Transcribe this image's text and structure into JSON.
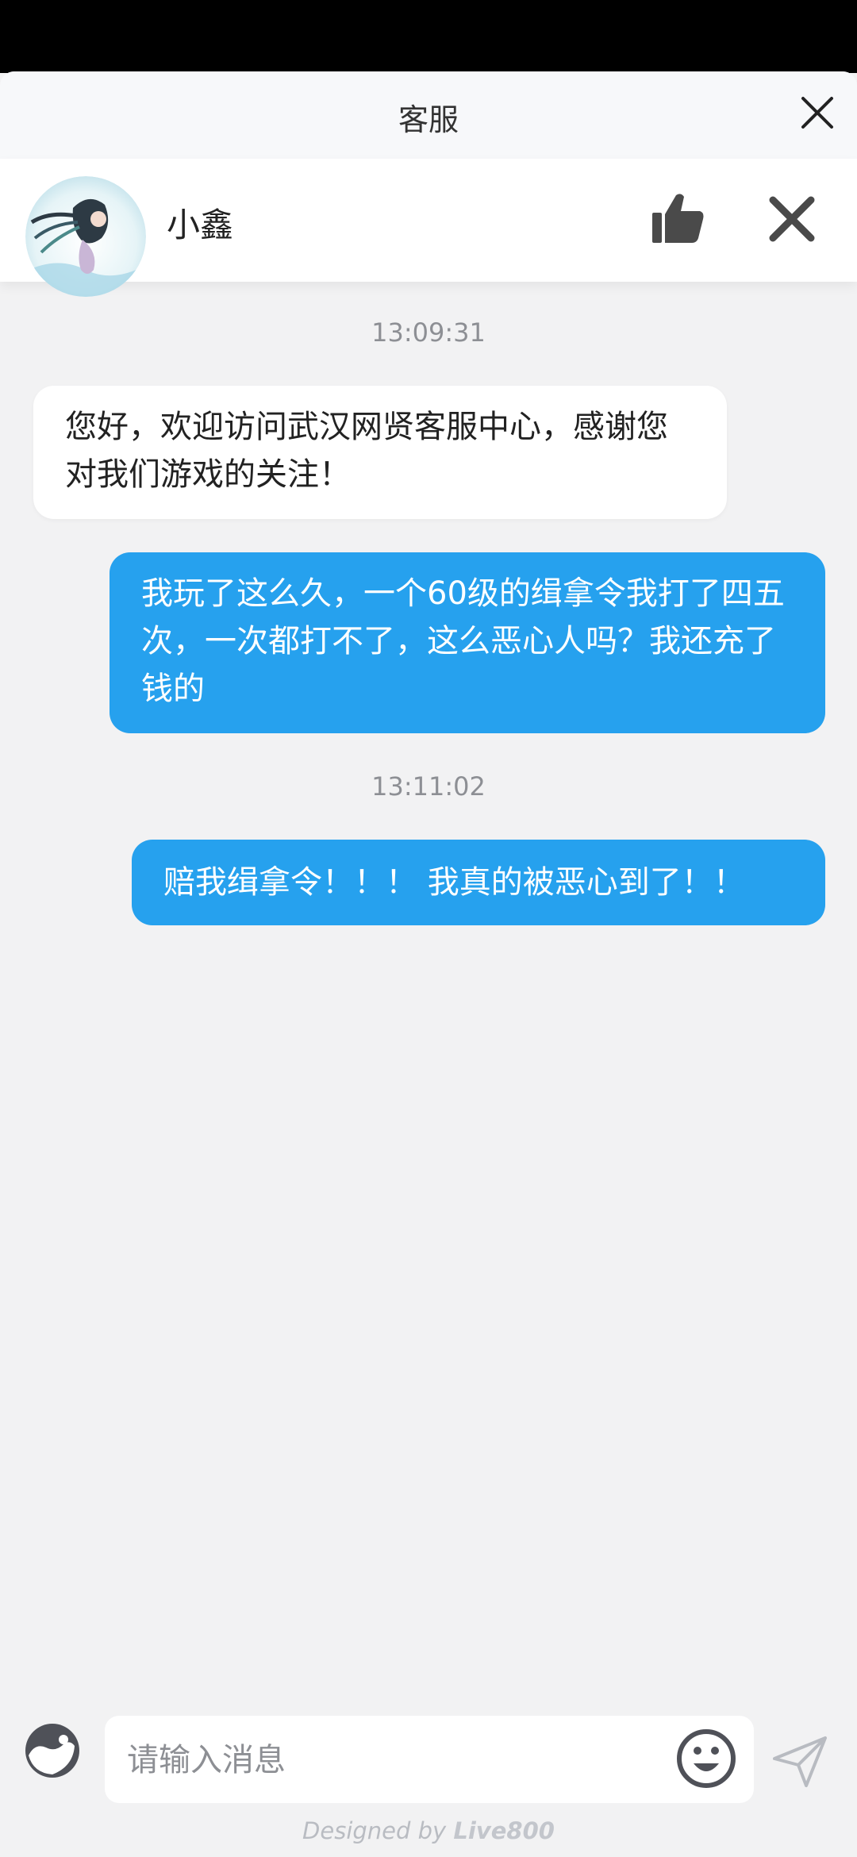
{
  "window": {
    "title": "客服"
  },
  "agent": {
    "name": "小鑫"
  },
  "messages": [
    {
      "type": "timestamp",
      "text": "13:09:31"
    },
    {
      "type": "incoming",
      "text": "您好，欢迎访问武汉网贤客服中心，感谢您对我们游戏的关注！"
    },
    {
      "type": "outgoing",
      "text": "我玩了这么久，一个60级的缉拿令我打了四五次，一次都打不了，这么恶心人吗？我还充了钱的"
    },
    {
      "type": "timestamp",
      "text": "13:11:02"
    },
    {
      "type": "outgoing",
      "text": "赔我缉拿令！！！ 我真的被恶心到了！！"
    }
  ],
  "composer": {
    "placeholder": "请输入消息",
    "value": ""
  },
  "footer": {
    "prefix": "Designed by ",
    "brand": "Live800"
  },
  "icons": {
    "close": "close-icon",
    "like": "thumbs-up-icon",
    "end_chat": "end-chat-icon",
    "tool": "yin-yang-icon",
    "emoji": "emoji-icon",
    "send": "send-icon"
  },
  "colors": {
    "outgoing_bubble": "#26a1ee",
    "incoming_bubble": "#ffffff",
    "background": "#f2f2f3"
  }
}
